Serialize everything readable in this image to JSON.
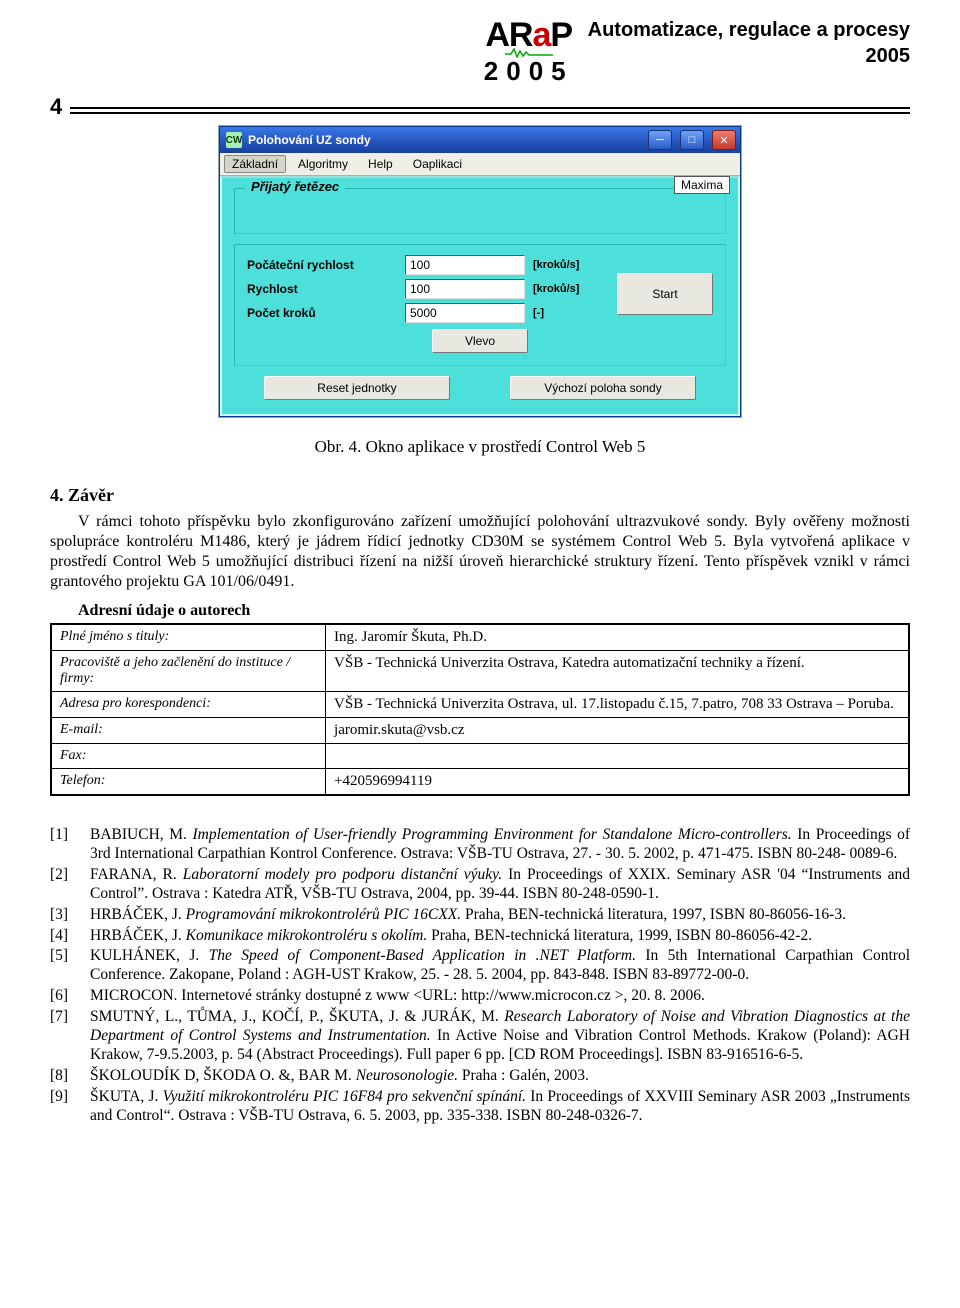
{
  "header": {
    "logo_text_1": "AR",
    "logo_text_red": "a",
    "logo_text_2": "P",
    "logo_year": "2005",
    "title": "Automatizace, regulace a procesy",
    "title_year": "2005"
  },
  "page_number": "4",
  "app_window": {
    "icon_text": "CW",
    "title": "Polohování UZ sondy",
    "menu": {
      "items": [
        "Základní",
        "Algoritmy",
        "Help",
        "Oaplikaci"
      ],
      "active_index": 0
    },
    "popup_label": "Maxima",
    "group_recv_title": "Přijatý řetězec",
    "fields": {
      "pocatecni_label": "Počáteční rychlost",
      "pocatecni_value": "100",
      "pocatecni_unit": "[kroků/s]",
      "rychlost_label": "Rychlost",
      "rychlost_value": "100",
      "rychlost_unit": "[kroků/s]",
      "pocet_label": "Počet kroků",
      "pocet_value": "5000",
      "pocet_unit": "[-]"
    },
    "buttons": {
      "start": "Start",
      "vlevo": "Vlevo",
      "reset": "Reset jednotky",
      "vychozi": "Výchozí poloha sondy"
    }
  },
  "caption": "Obr. 4. Okno aplikace v prostředí Control Web 5",
  "section": {
    "heading": "4.   Závěr",
    "para": "V rámci tohoto příspěvku bylo zkonfigurováno zařízení umožňující polohování ultrazvukové sondy. Byly ověřeny možnosti spolupráce kontroléru M1486, který je jádrem řídicí jednotky CD30M se systémem Control Web 5. Byla vytvořená aplikace v prostředí Control Web 5 umožňující distribuci řízení na nižší úroveň hierarchické struktury řízení. Tento příspěvek vznikl v rámci grantového projektu GA 101/06/0491.",
    "subheading": "Adresní údaje o autorech"
  },
  "author_table": {
    "rows": [
      {
        "label": "Plné jméno s tituly:",
        "value": "Ing. Jaromír Škuta, Ph.D."
      },
      {
        "label": "Pracoviště a jeho začlenění do instituce / firmy:",
        "value": "VŠB - Technická Univerzita Ostrava, Katedra automatizační techniky a řízení."
      },
      {
        "label": "Adresa pro korespondenci:",
        "value": "VŠB - Technická Univerzita Ostrava, ul. 17.listopadu č.15, 7.patro, 708 33 Ostrava – Poruba."
      },
      {
        "label": "E-mail:",
        "value": "jaromir.skuta@vsb.cz"
      },
      {
        "label": "Fax:",
        "value": ""
      },
      {
        "label": "Telefon:",
        "value": "+420596994119"
      }
    ]
  },
  "references": [
    {
      "num": "[1]",
      "text": "BABIUCH, M. <em>Implementation of User-friendly Programming Environment for Standalone Micro-controllers.</em> In Proceedings of 3rd International Carpathian Kontrol Conference. Ostrava: VŠB-TU Ostrava, 27. - 30. 5. 2002, p. 471-475. ISBN 80-248- 0089-6."
    },
    {
      "num": "[2]",
      "text": "FARANA, R. <em>Laboratorní modely pro podporu distanční výuky.</em> In Proceedings of XXIX. Seminary ASR '04 “Instruments and Control”. Ostrava : Katedra ATŘ, VŠB-TU Ostrava, 2004, pp. 39-44. ISBN 80-248-0590-1."
    },
    {
      "num": "[3]",
      "text": "HRBÁČEK, J. <em>Programování mikrokontrolérů PIC 16CXX.</em> Praha, BEN-technická literatura, 1997, ISBN 80-86056-16-3."
    },
    {
      "num": "[4]",
      "text": "HRBÁČEK, J. <em>Komunikace mikrokontroléru s okolím.</em> Praha, BEN-technická literatura, 1999, ISBN 80-86056-42-2."
    },
    {
      "num": "[5]",
      "text": "KULHÁNEK, J. <em>The Speed of Component-Based Application in .NET Platform.</em> In 5th International Carpathian Control Conference. Zakopane, Poland : AGH-UST Krakow, 25. - 28. 5. 2004, pp. 843-848. ISBN 83-89772-00-0."
    },
    {
      "num": "[6]",
      "text": "MICROCON. Internetové stránky dostupné z www &lt;URL: http://www.microcon.cz &gt;, 20. 8. 2006."
    },
    {
      "num": "[7]",
      "text": "SMUTNÝ, L., TŮMA, J., KOČÍ, P., ŠKUTA, J. &amp; JURÁK, M. <em>Research Laboratory of Noise and Vibration Diagnostics at the Department of Control Systems and Instrumentation.</em> In Active Noise and Vibration Control Methods. Krakow (Poland): AGH Krakow, 7-9.5.2003, p. 54 (Abstract Proceedings). Full paper 6 pp. [CD ROM Proceedings]. ISBN 83-916516-6-5."
    },
    {
      "num": "[8]",
      "text": "ŠKOLOUDÍK D, ŠKODA O. &amp;, BAR M. <em>Neurosonologie.</em> Praha : Galén, 2003."
    },
    {
      "num": "[9]",
      "text": "ŠKUTA, J. <em>Využití mikrokontroléru PIC 16F84 pro sekvenční spínání.</em> In Proceedings of XXVIII Seminary ASR 2003 „Instruments and Control“. Ostrava : VŠB-TU Ostrava, 6. 5. 2003, pp. 335-338. ISBN 80-248-0326-7."
    }
  ]
}
